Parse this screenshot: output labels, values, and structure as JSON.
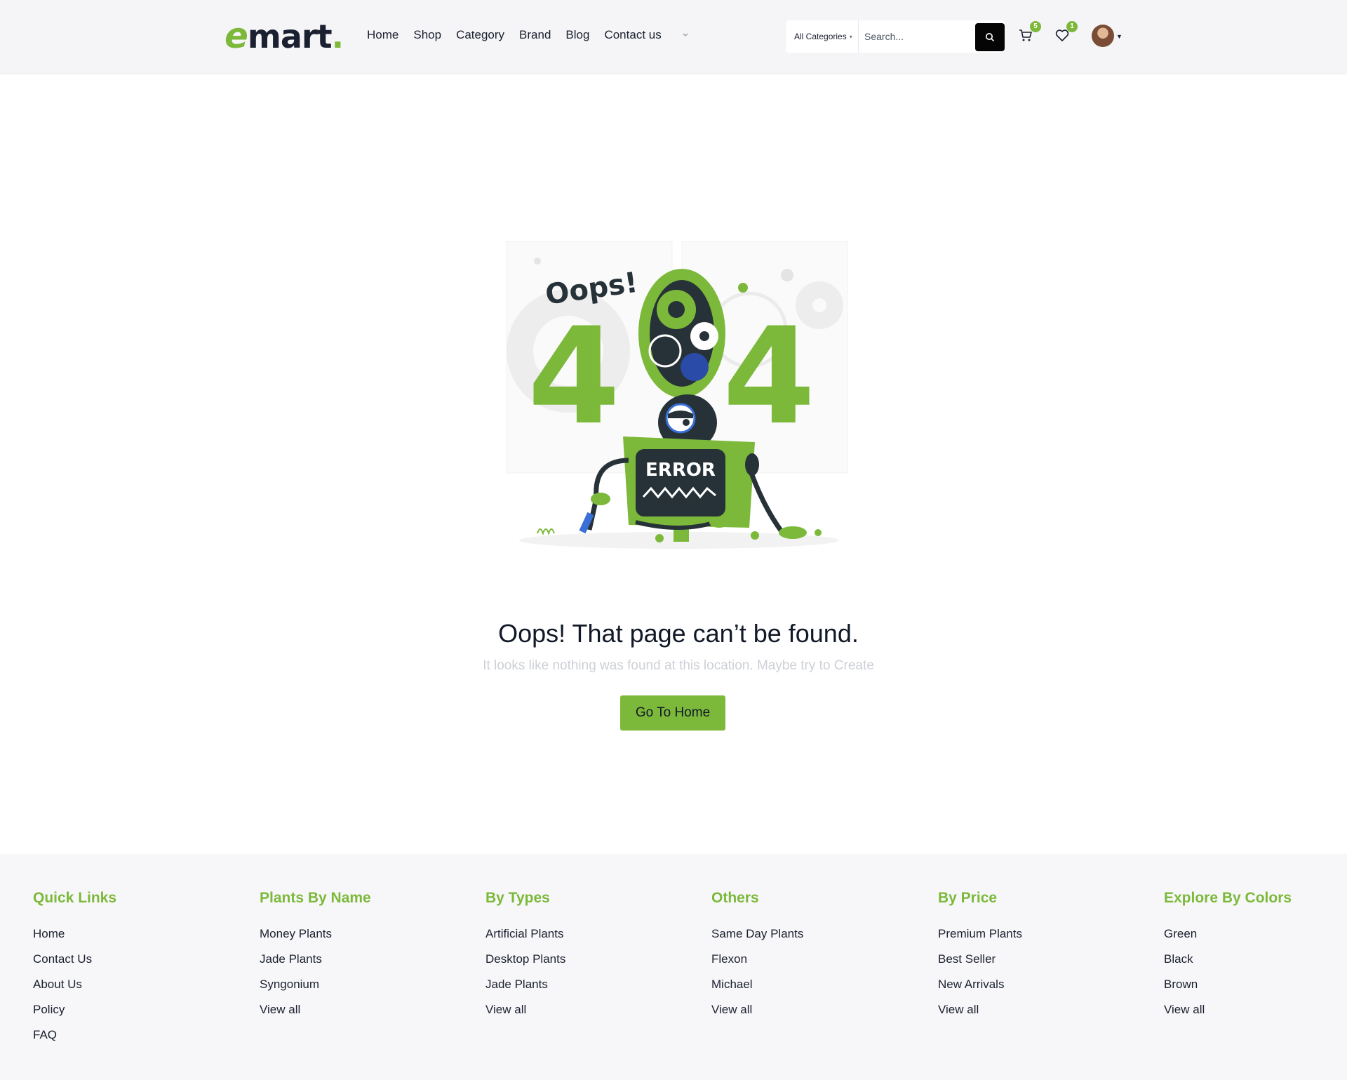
{
  "brand": {
    "logo_main": "e",
    "logo_rest": "mart",
    "logo_dot": ".",
    "accent_color": "#7cb93a"
  },
  "nav": {
    "items": [
      "Home",
      "Shop",
      "Category",
      "Brand",
      "Blog",
      "Contact us"
    ],
    "more_icon": "chevron-down-icon"
  },
  "search": {
    "category_label": "All Categories",
    "placeholder": "Search..."
  },
  "cart": {
    "count": "5"
  },
  "wishlist": {
    "count": "1"
  },
  "error": {
    "illustration_text_oops": "Oops!",
    "illustration_text_404_left": "4",
    "illustration_text_404_right": "4",
    "illustration_text_error": "ERROR",
    "title": "Oops! That page can’t be found.",
    "subtitle": "It looks like nothing was found at this location. Maybe try to Create",
    "button": "Go To Home"
  },
  "footer": {
    "columns": [
      {
        "heading": "Quick Links",
        "links": [
          "Home",
          "Contact Us",
          "About Us",
          "Policy",
          "FAQ"
        ]
      },
      {
        "heading": "Plants By Name",
        "links": [
          "Money Plants",
          "Jade Plants",
          "Syngonium",
          "View all"
        ]
      },
      {
        "heading": "By Types",
        "links": [
          "Artificial Plants",
          "Desktop Plants",
          "Jade Plants",
          "View all"
        ]
      },
      {
        "heading": "Others",
        "links": [
          "Same Day Plants",
          "Flexon",
          "Michael",
          "View all"
        ]
      },
      {
        "heading": "By Price",
        "links": [
          "Premium Plants",
          "Best Seller",
          "New Arrivals",
          "View all"
        ]
      },
      {
        "heading": "Explore By Colors",
        "links": [
          "Green",
          "Black",
          "Brown",
          "View all"
        ]
      }
    ]
  }
}
